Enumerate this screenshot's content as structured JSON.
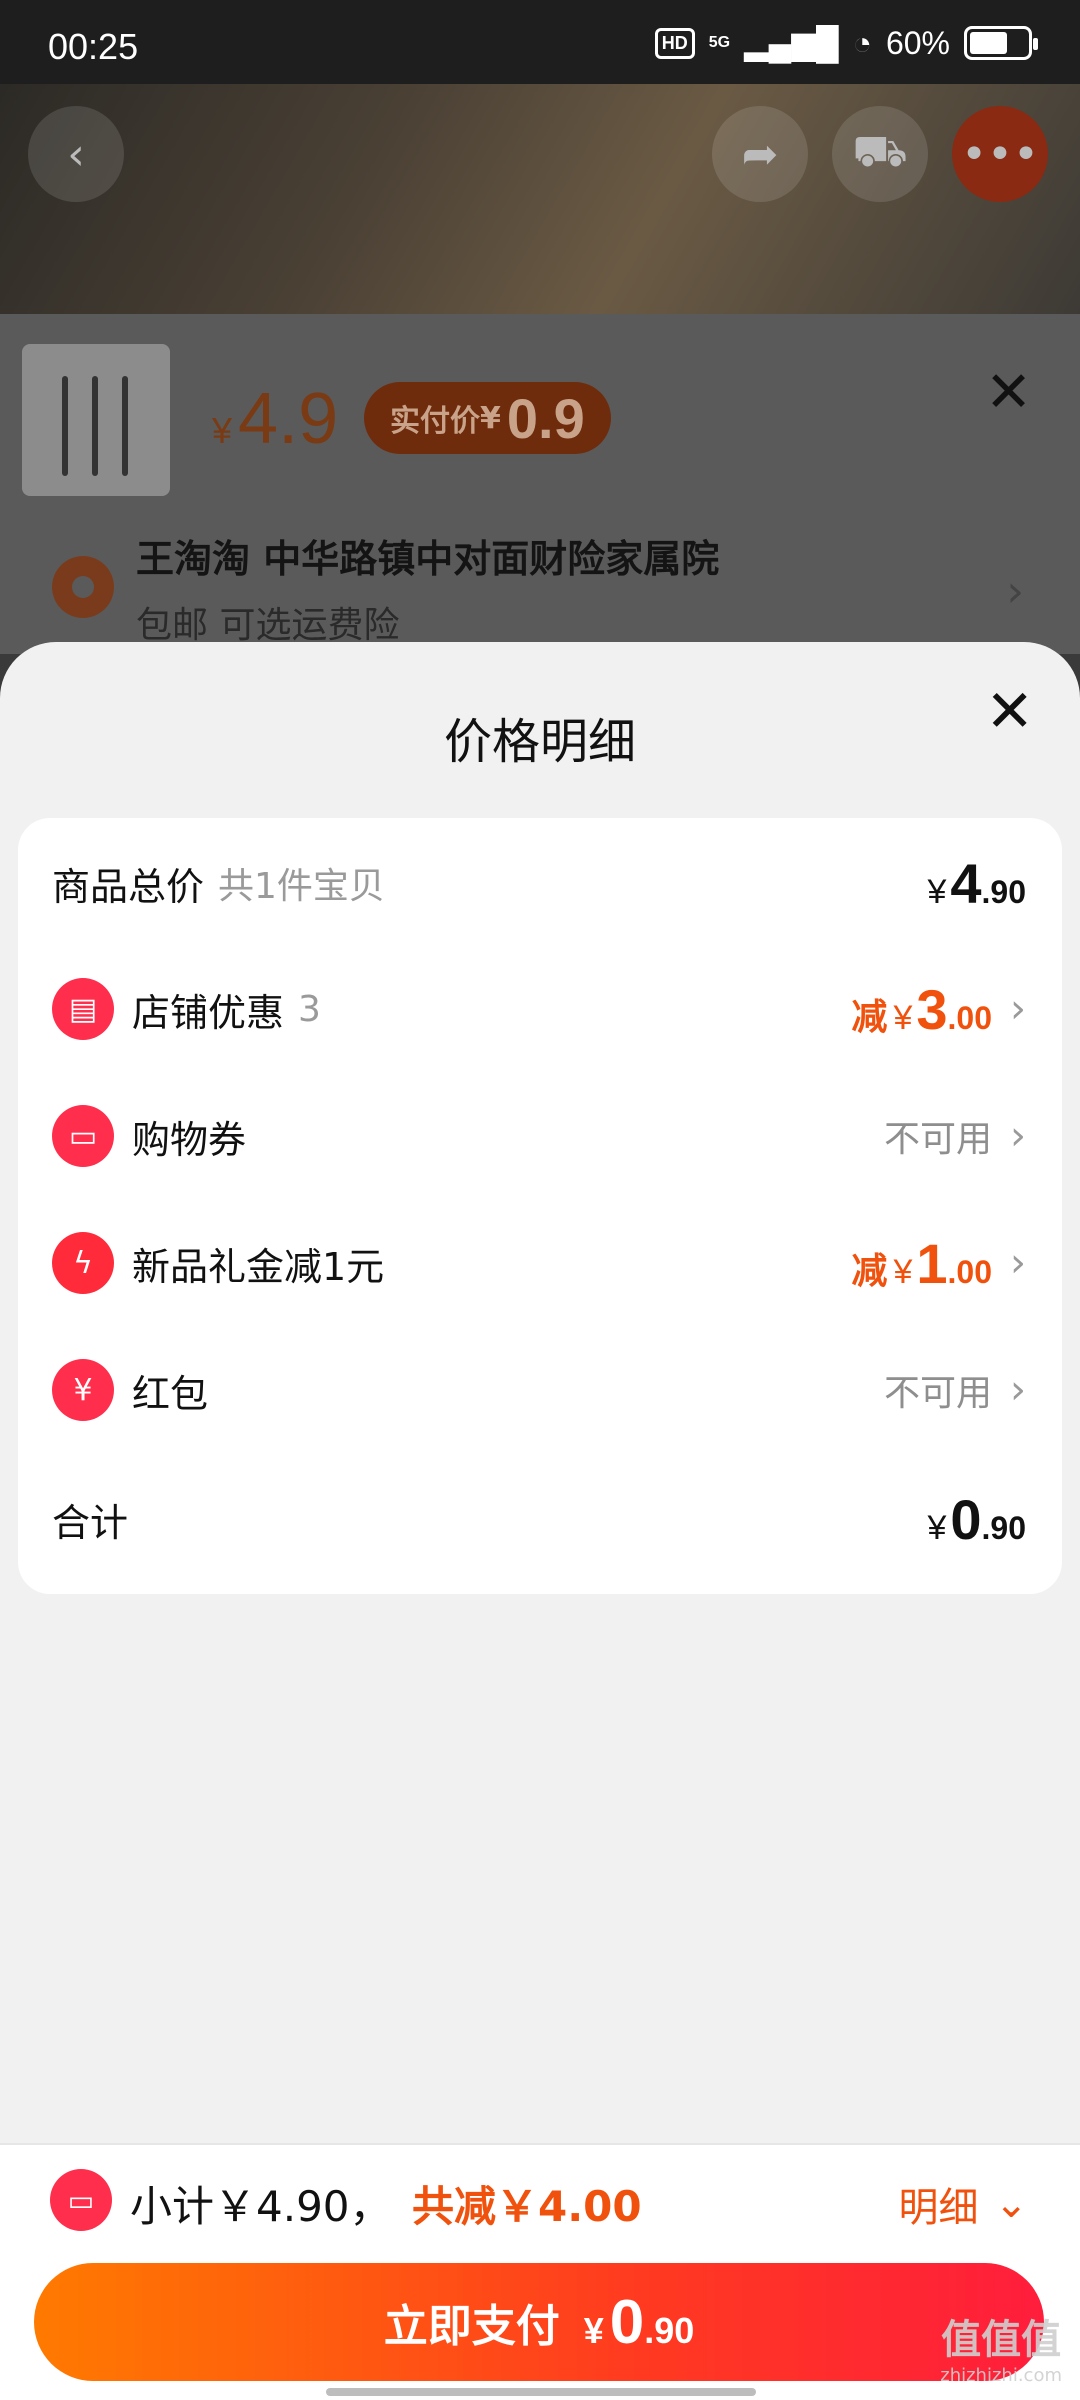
{
  "status_bar": {
    "time": "00:25",
    "hd": "HD",
    "network": "5G",
    "battery": "60%"
  },
  "sku": {
    "price": "4.9",
    "currency": "¥",
    "pay_label": "实付价",
    "pay_value": "0.9",
    "address_title": "王淘淘 中华路镇中对面财险家属院",
    "address_sub": "包邮  可选运费险"
  },
  "sheet": {
    "title": "价格明细",
    "rows": [
      {
        "label": "商品总价",
        "note": "共1件宝贝",
        "amount_int": "4",
        "amount_dec": ".90",
        "currency": "¥"
      },
      {
        "label": "店铺优惠",
        "note": "3",
        "prefix": "减",
        "amount_int": "3",
        "amount_dec": ".00",
        "currency": "¥"
      },
      {
        "label": "购物券",
        "status": "不可用"
      },
      {
        "label": "新品礼金减1元",
        "prefix": "减",
        "amount_int": "1",
        "amount_dec": ".00",
        "currency": "¥"
      },
      {
        "label": "红包",
        "status": "不可用"
      },
      {
        "label": "合计",
        "amount_int": "0",
        "amount_dec": ".90",
        "currency": "¥"
      }
    ]
  },
  "bottom": {
    "subtotal": "小计￥4.90，",
    "discount": "共减￥4.00",
    "detail": "明细",
    "pay_label": "立即支付",
    "pay_currency": "¥",
    "pay_int": "0",
    "pay_dec": ".90"
  },
  "watermark": {
    "main": "值值值",
    "sub": "zhizhizhi.com"
  },
  "colors": {
    "accent": "#f0520e",
    "red_icon": "#ff2e4c",
    "sheet_bg": "#f1f1f1"
  }
}
